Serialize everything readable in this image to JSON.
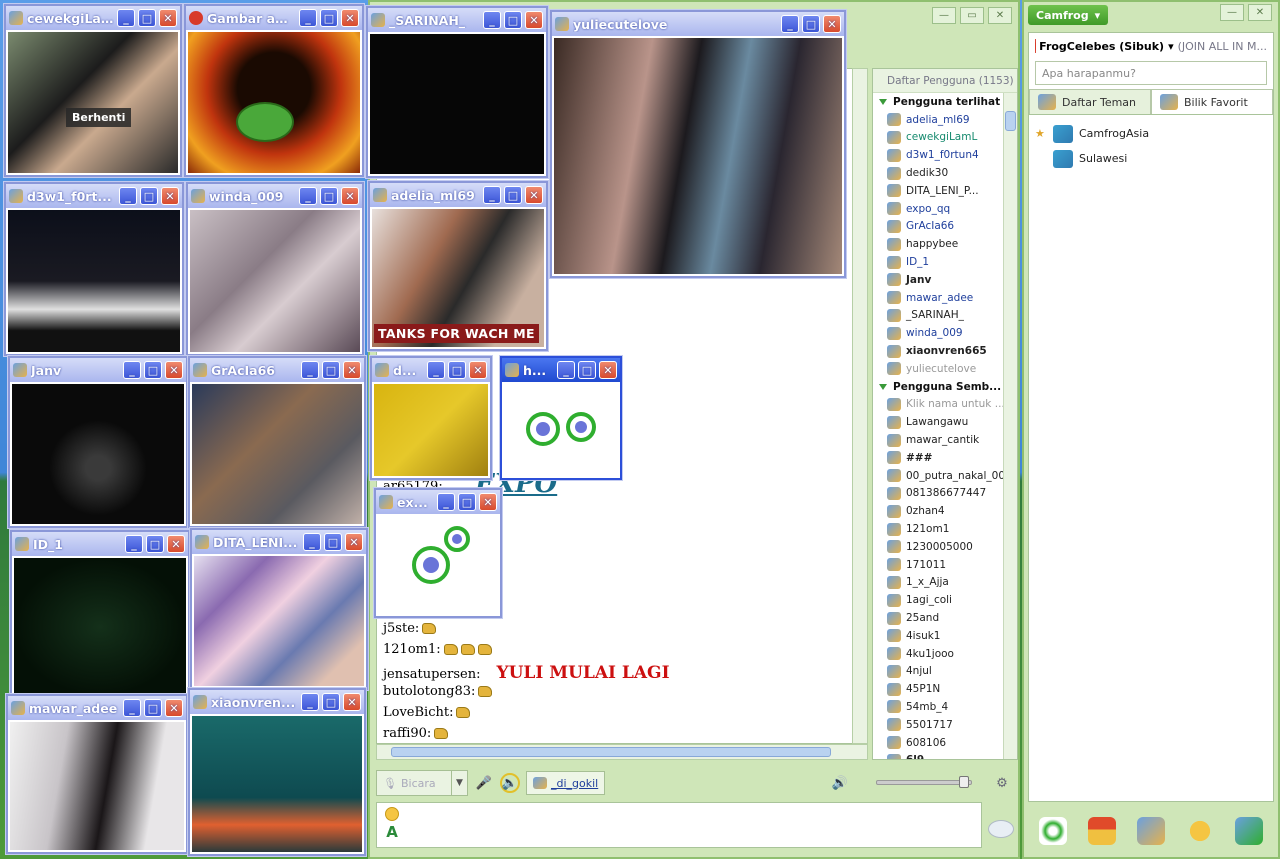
{
  "room": {
    "controls": [
      "minimize",
      "restore",
      "close"
    ],
    "user_list_header": "Daftar Pengguna (1153)",
    "groups": [
      {
        "label": "Pengguna terlihat",
        "users": [
          {
            "name": "adelia_ml69",
            "style": "blue"
          },
          {
            "name": "cewekgiLamL",
            "style": "teal"
          },
          {
            "name": "d3w1_f0rtun4",
            "style": "blue"
          },
          {
            "name": "dedik30",
            "style": ""
          },
          {
            "name": "DITA_LENI_P...",
            "style": ""
          },
          {
            "name": "expo_qq",
            "style": "blue"
          },
          {
            "name": "GrAcIa66",
            "style": "blue"
          },
          {
            "name": "happybee",
            "style": ""
          },
          {
            "name": "ID_1",
            "style": "blue"
          },
          {
            "name": "Janv",
            "style": "bold"
          },
          {
            "name": "mawar_adee",
            "style": "blue"
          },
          {
            "name": "_SARINAH_",
            "style": ""
          },
          {
            "name": "winda_009",
            "style": "blue"
          },
          {
            "name": "xiaonvren665",
            "style": "bold"
          },
          {
            "name": "yuliecutelove",
            "style": "muted"
          }
        ]
      },
      {
        "label": "Pengguna Semb...",
        "users": [
          {
            "name": "Klik nama untuk ...",
            "style": "muted"
          },
          {
            "name": "Lawangawu",
            "style": ""
          },
          {
            "name": "mawar_cantik",
            "style": ""
          },
          {
            "name": "###",
            "style": "bold"
          },
          {
            "name": "00_putra_nakal_00",
            "style": ""
          },
          {
            "name": "081386677447",
            "style": ""
          },
          {
            "name": "0zhan4",
            "style": ""
          },
          {
            "name": "121om1",
            "style": ""
          },
          {
            "name": "1230005000",
            "style": ""
          },
          {
            "name": "171011",
            "style": ""
          },
          {
            "name": "1_x_Ajja",
            "style": ""
          },
          {
            "name": "1agi_coli",
            "style": ""
          },
          {
            "name": "25and",
            "style": ""
          },
          {
            "name": "4isuk1",
            "style": ""
          },
          {
            "name": "4ku1jooo",
            "style": ""
          },
          {
            "name": "4njul",
            "style": ""
          },
          {
            "name": "45P1N",
            "style": ""
          },
          {
            "name": "54mb_4",
            "style": ""
          },
          {
            "name": "5501717",
            "style": ""
          },
          {
            "name": "608106",
            "style": ""
          },
          {
            "name": "6l9",
            "style": "bold"
          }
        ]
      }
    ],
    "chat": {
      "fragment_partial_1": "c",
      "fragment_partial_2": "nn",
      "expo_banner": "EXPO",
      "partial_user": "ar65179:",
      "lines": [
        {
          "user": "j5ste:",
          "thumbs": 1,
          "text": ""
        },
        {
          "user": "121om1:",
          "thumbs": 3,
          "text": ""
        },
        {
          "user": "jensatupersen:",
          "thumbs": 0,
          "text": "YULI MULAI LAGI"
        },
        {
          "user": "butolotong83:",
          "thumbs": 1,
          "text": ""
        },
        {
          "user": "LoveBicht:",
          "thumbs": 1,
          "text": ""
        },
        {
          "user": "raffi90:",
          "thumbs": 1,
          "text": ""
        }
      ]
    },
    "talk_button": "Bicara",
    "cam_user": "_di_gokil"
  },
  "videos": [
    {
      "name": "cewekgiLamL",
      "overlay": "Berhenti"
    },
    {
      "name": "Gambar anda",
      "overlay": ""
    },
    {
      "name": "_SARINAH_",
      "overlay": ""
    },
    {
      "name": "yuliecutelove",
      "overlay": ""
    },
    {
      "name": "d3w1_f0rt...",
      "overlay": ""
    },
    {
      "name": "winda_009",
      "overlay": ""
    },
    {
      "name": "adelia_ml69",
      "overlay": "TANKS FOR WACH ME"
    },
    {
      "name": "Janv",
      "overlay": ""
    },
    {
      "name": "GrAcIa66",
      "overlay": ""
    },
    {
      "name": "d...",
      "overlay": ""
    },
    {
      "name": "h...",
      "overlay": ""
    },
    {
      "name": "ID_1",
      "overlay": ""
    },
    {
      "name": "DITA_LENI...",
      "overlay": ""
    },
    {
      "name": "ex...",
      "overlay": ""
    },
    {
      "name": "mawar_adee",
      "overlay": ""
    },
    {
      "name": "xiaonvren...",
      "overlay": ""
    }
  ],
  "right_panel": {
    "menu": "Camfrog",
    "status_user": "FrogCelebes (Sibuk)",
    "status_hint": "(JOIN ALL IN M...",
    "search_placeholder": "Apa harapanmu?",
    "tabs": [
      {
        "label": "Daftar Teman"
      },
      {
        "label": "Bilik Favorit"
      }
    ],
    "favorites": [
      {
        "name": "CamfrogAsia",
        "starred": true
      },
      {
        "name": "Sulawesi",
        "starred": false
      }
    ]
  }
}
